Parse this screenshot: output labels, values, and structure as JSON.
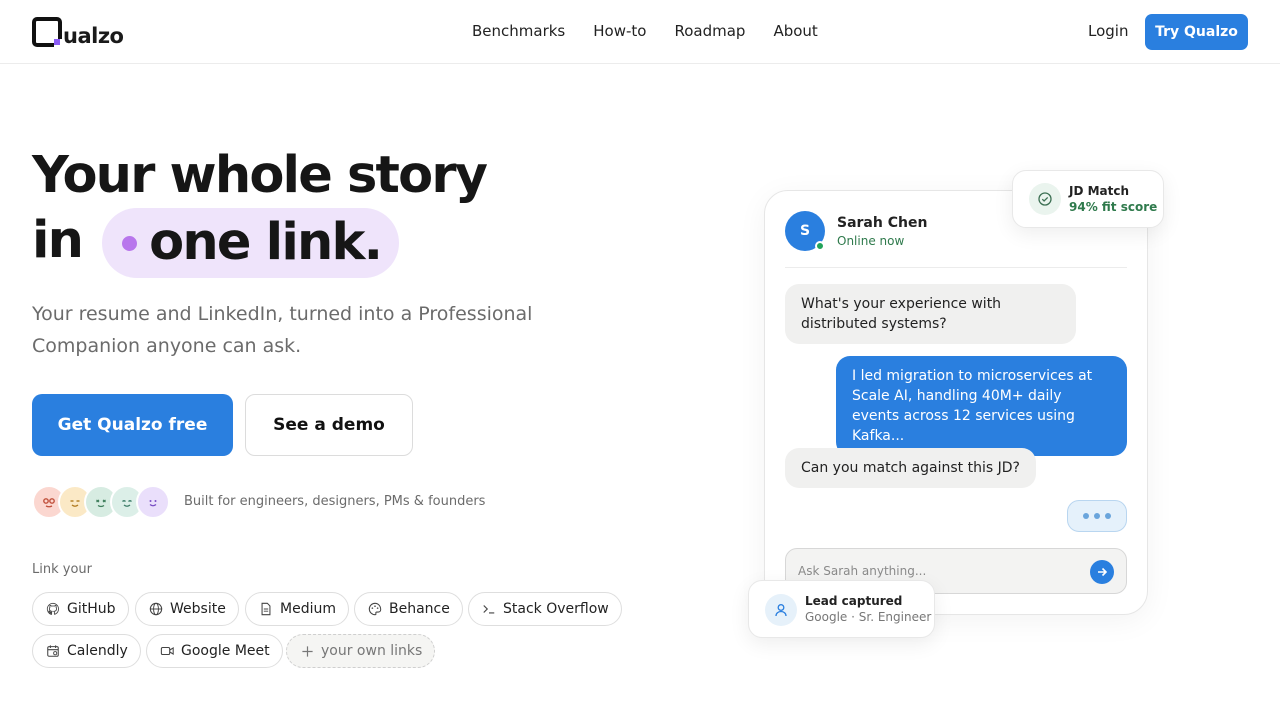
{
  "brand": {
    "name": "ualzo"
  },
  "nav": {
    "links": [
      "Benchmarks",
      "How-to",
      "Roadmap",
      "About"
    ],
    "login": "Login",
    "cta": "Try Qualzo"
  },
  "hero": {
    "title_line1": "Your whole story",
    "title_in": "in",
    "title_highlight": "one link.",
    "subtitle": "Your resume and LinkedIn, turned into a Professional Companion anyone can ask.",
    "primary_cta": "Get Qualzo free",
    "secondary_cta": "See a demo",
    "audience": "Built for engineers, designers, PMs & founders"
  },
  "links": {
    "label": "Link your",
    "chips": [
      {
        "label": "GitHub",
        "icon": "github-icon"
      },
      {
        "label": "Website",
        "icon": "globe-icon"
      },
      {
        "label": "Medium",
        "icon": "document-icon"
      },
      {
        "label": "Behance",
        "icon": "palette-icon"
      },
      {
        "label": "Stack Overflow",
        "icon": "terminal-icon"
      },
      {
        "label": "Calendly",
        "icon": "calendar-icon"
      },
      {
        "label": "Google Meet",
        "icon": "video-icon"
      },
      {
        "label": "your own links",
        "icon": "plus-icon"
      }
    ]
  },
  "chat": {
    "avatar_initial": "S",
    "name": "Sarah Chen",
    "status": "Online now",
    "messages": [
      {
        "from": "visitor",
        "text": "What's your experience with distributed systems?"
      },
      {
        "from": "companion",
        "text": "I led migration to microservices at Scale AI, handling 40M+ daily events across 12 services using Kafka..."
      },
      {
        "from": "visitor",
        "text": "Can you match against this JD?"
      }
    ],
    "input_placeholder": "Ask Sarah anything..."
  },
  "badges": {
    "jd_title": "JD Match",
    "jd_score": "94% fit score",
    "lead_title": "Lead captured",
    "lead_sub": "Google · Sr. Engineer"
  },
  "colors": {
    "accent": "#2a7fdf",
    "highlight_bg": "#efe4fb",
    "highlight_dot": "#b876ec",
    "success": "#2f7a4c"
  }
}
